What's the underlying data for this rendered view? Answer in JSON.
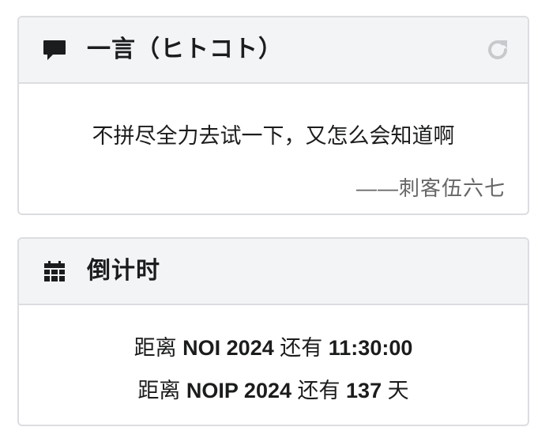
{
  "hitokoto": {
    "title": "一言（ヒトコト）",
    "text": "不拼尽全力去试一下，又怎么会知道啊",
    "from": "——刺客伍六七",
    "refresh_icon": "refresh-icon",
    "header_icon": "comment-icon"
  },
  "countdown": {
    "title": "倒计时",
    "header_icon": "calendar-icon",
    "items": [
      {
        "prefix": "距离",
        "event": "NOI 2024",
        "middle": "还有",
        "value": "11:30:00",
        "suffix": ""
      },
      {
        "prefix": "距离",
        "event": "NOIP 2024",
        "middle": "还有",
        "value": "137",
        "suffix": "天"
      }
    ]
  }
}
